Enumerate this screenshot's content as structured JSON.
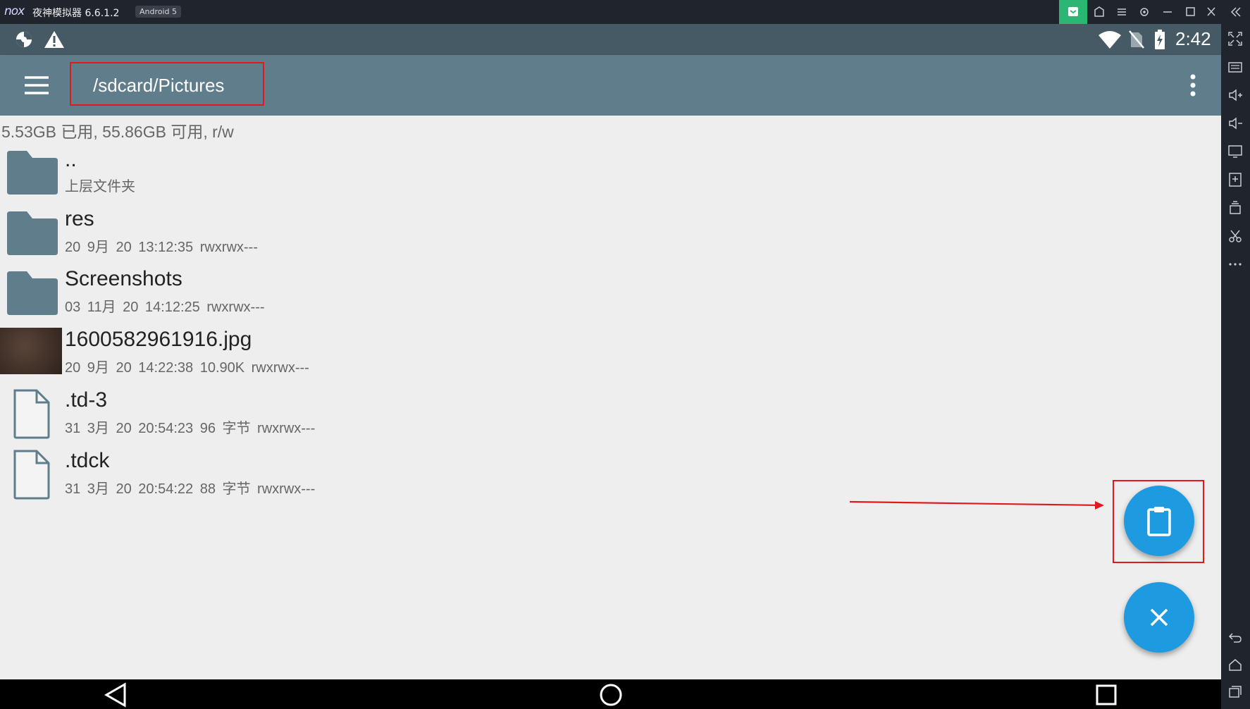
{
  "window": {
    "logo_text": "nox",
    "title": "夜神模拟器 6.6.1.2",
    "android_badge": "Android 5"
  },
  "status_bar": {
    "time": "2:42"
  },
  "toolbar": {
    "path": "/sdcard/Pictures"
  },
  "storage_info": "5.53GB 已用, 55.86GB 可用, r/w",
  "files": [
    {
      "name": "..",
      "meta": "上层文件夹",
      "type": "folder"
    },
    {
      "name": "res",
      "meta": "20 9月 20 13:12:35   rwxrwx---",
      "type": "folder"
    },
    {
      "name": "Screenshots",
      "meta": "03 11月 20 14:12:25   rwxrwx---",
      "type": "folder"
    },
    {
      "name": "1600582961916.jpg",
      "meta": "20 9月 20 14:22:38  10.90K  rwxrwx---",
      "type": "image"
    },
    {
      "name": ".td-3",
      "meta": "31 3月 20 20:54:23  96 字节  rwxrwx---",
      "type": "file"
    },
    {
      "name": ".tdck",
      "meta": "31 3月 20 20:54:22  88 字节  rwxrwx---",
      "type": "file"
    }
  ],
  "colors": {
    "status_bar": "#455a64",
    "toolbar": "#607d8b",
    "fab": "#1e9ae0",
    "annotation": "#e0191f",
    "folder_icon": "#607d8b"
  }
}
